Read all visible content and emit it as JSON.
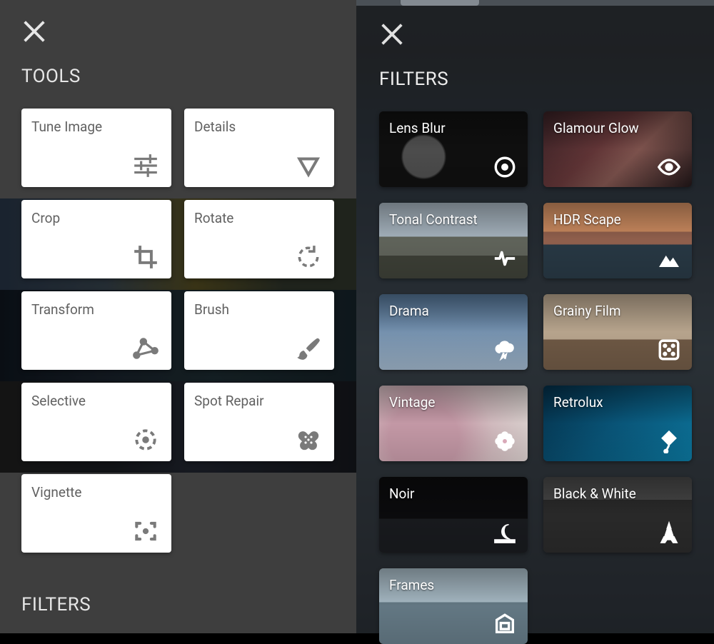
{
  "left": {
    "sections": {
      "tools": "TOOLS",
      "filters": "FILTERS"
    },
    "tools": [
      {
        "label": "Tune Image",
        "icon": "sliders-icon"
      },
      {
        "label": "Details",
        "icon": "triangle-down-icon"
      },
      {
        "label": "Crop",
        "icon": "crop-icon"
      },
      {
        "label": "Rotate",
        "icon": "rotate-icon"
      },
      {
        "label": "Transform",
        "icon": "transform-icon"
      },
      {
        "label": "Brush",
        "icon": "brush-icon"
      },
      {
        "label": "Selective",
        "icon": "target-dashed-icon"
      },
      {
        "label": "Spot Repair",
        "icon": "bandage-icon"
      },
      {
        "label": "Vignette",
        "icon": "focus-square-icon"
      }
    ]
  },
  "right": {
    "sections": {
      "filters": "FILTERS"
    },
    "filters": [
      {
        "label": "Lens Blur",
        "icon": "aperture-dot-icon"
      },
      {
        "label": "Glamour Glow",
        "icon": "eye-icon"
      },
      {
        "label": "Tonal Contrast",
        "icon": "pulse-icon"
      },
      {
        "label": "HDR Scape",
        "icon": "mountains-icon"
      },
      {
        "label": "Drama",
        "icon": "storm-cloud-icon"
      },
      {
        "label": "Grainy Film",
        "icon": "dice-icon"
      },
      {
        "label": "Vintage",
        "icon": "flower-icon"
      },
      {
        "label": "Retrolux",
        "icon": "kite-icon"
      },
      {
        "label": "Noir",
        "icon": "moon-horizon-icon"
      },
      {
        "label": "Black & White",
        "icon": "eiffel-icon"
      },
      {
        "label": "Frames",
        "icon": "frame-icon"
      }
    ]
  }
}
